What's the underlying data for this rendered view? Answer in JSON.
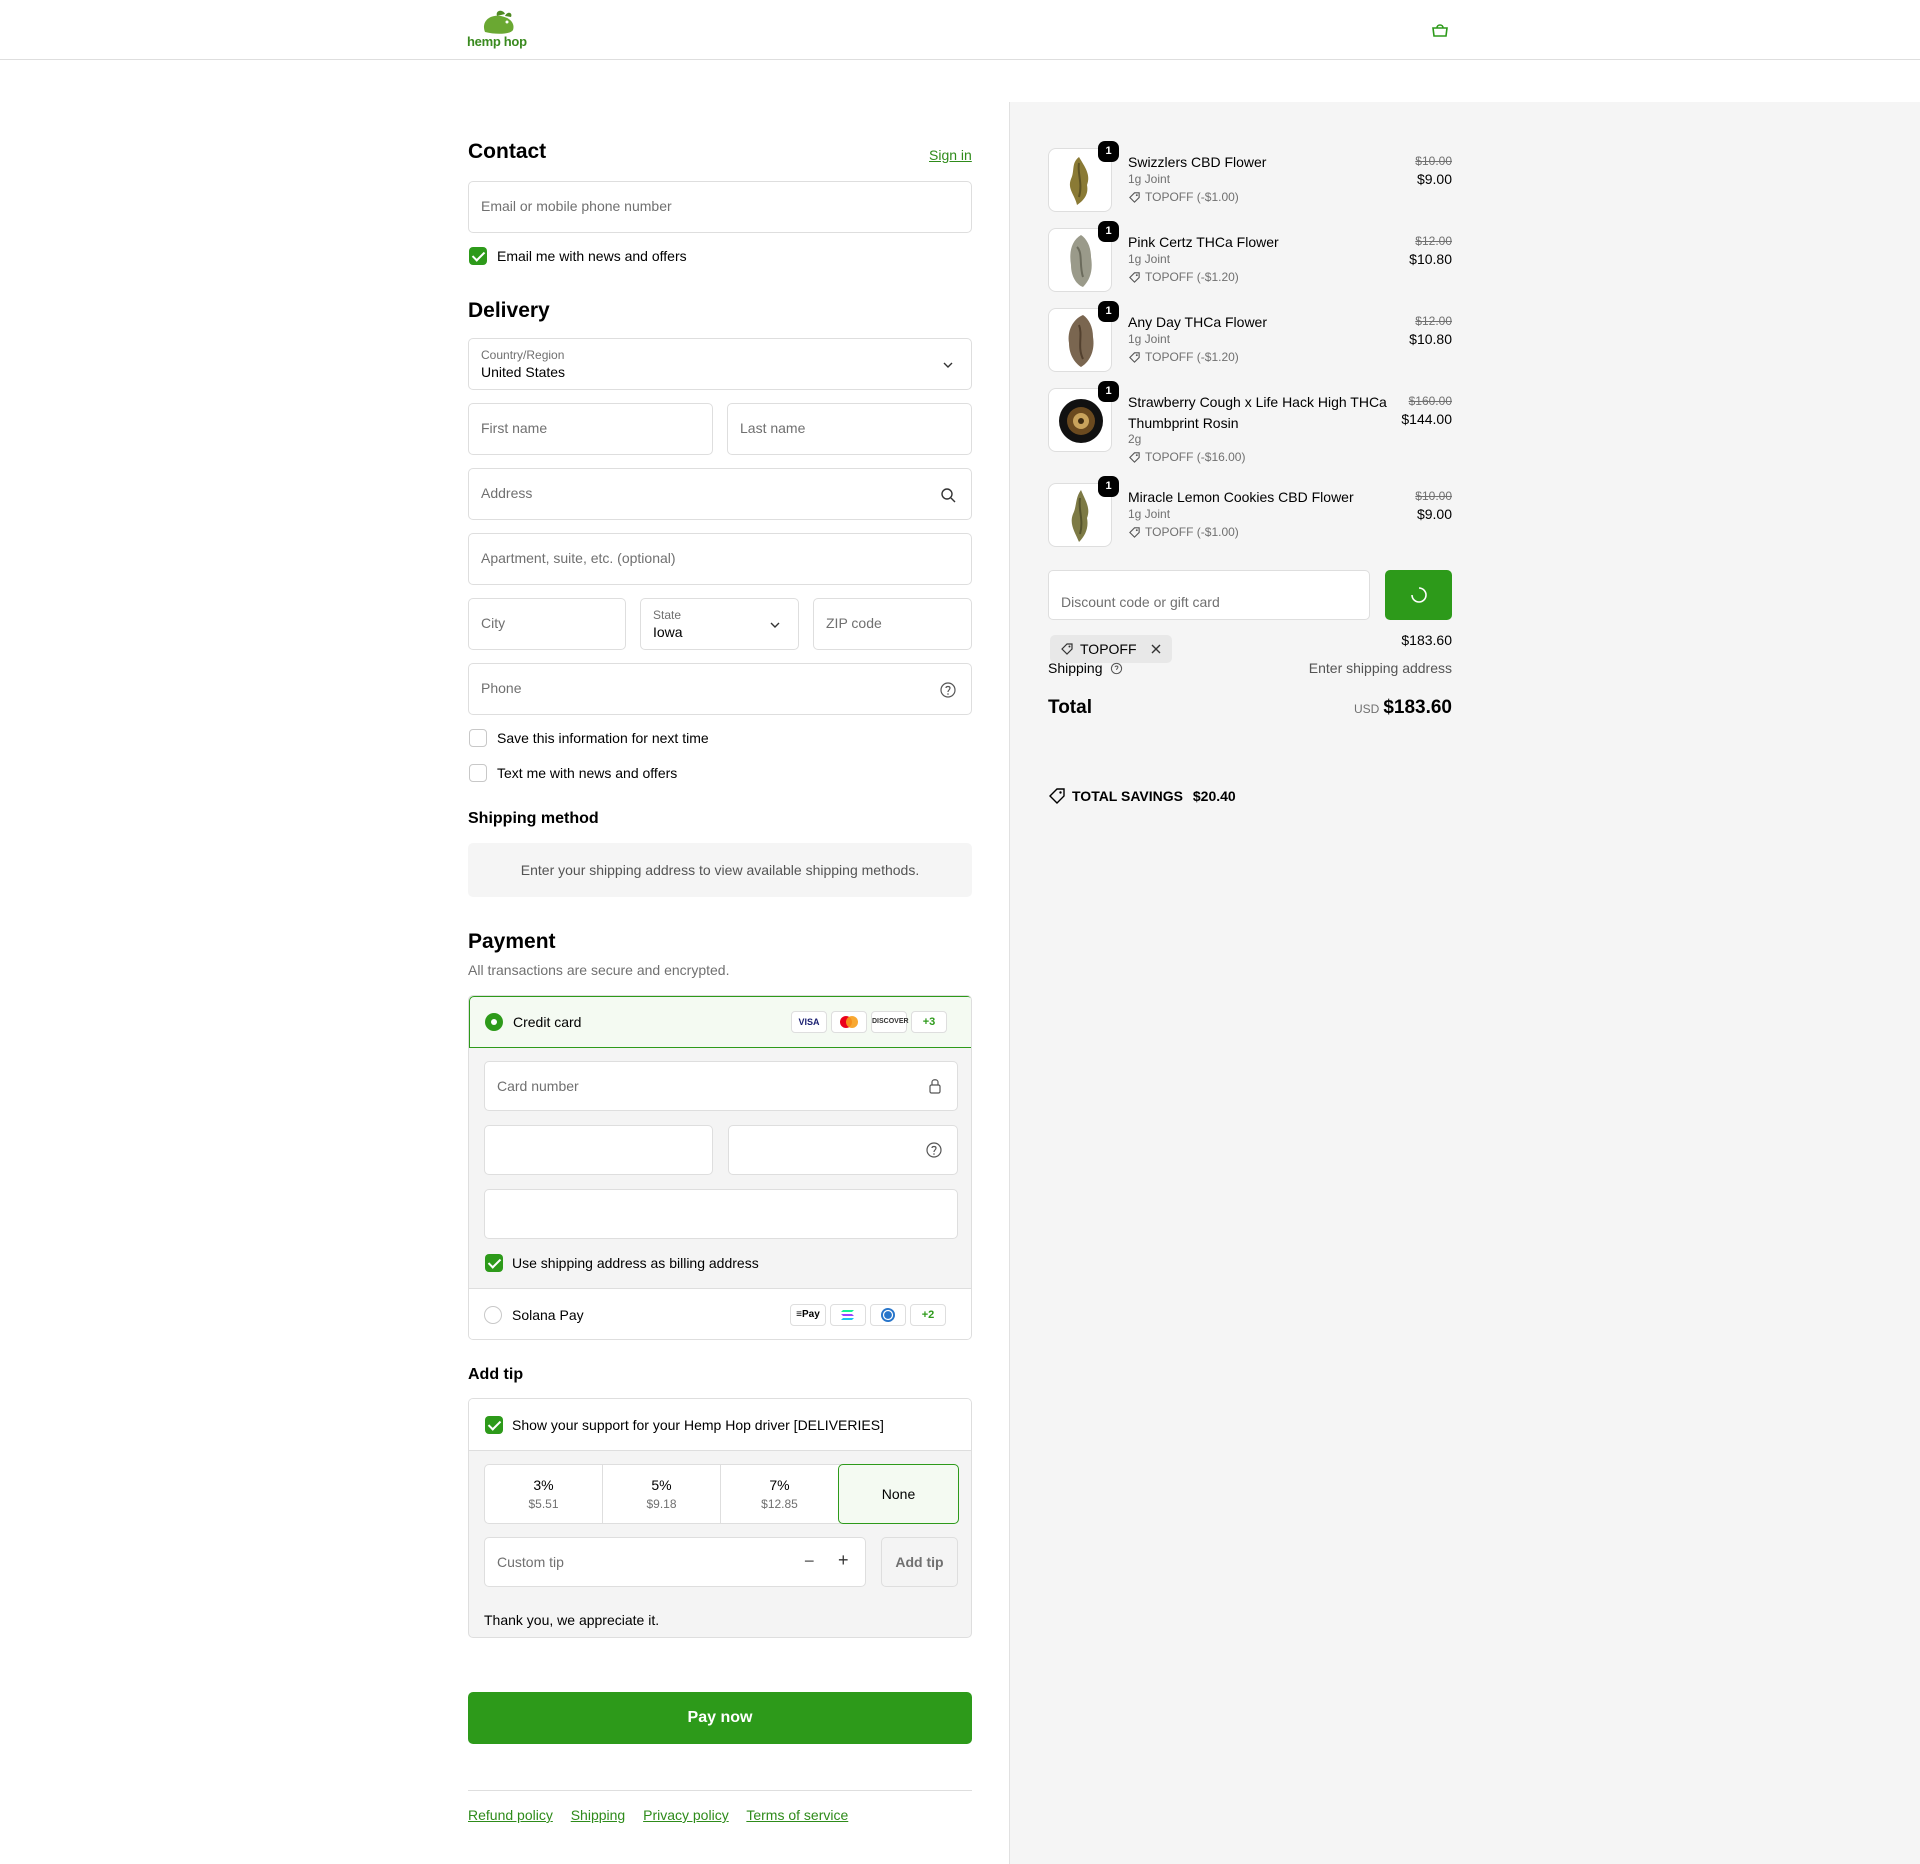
{
  "header": {
    "logo_text": "hemp hop"
  },
  "contact": {
    "title": "Contact",
    "sign_in": "Sign in",
    "email_placeholder": "Email or mobile phone number",
    "news_label": "Email me with news and offers"
  },
  "delivery": {
    "title": "Delivery",
    "country_label": "Country/Region",
    "country_value": "United States",
    "first_name": "First name",
    "last_name": "Last name",
    "address": "Address",
    "apartment": "Apartment, suite, etc. (optional)",
    "city": "City",
    "state_label": "State",
    "state_value": "Iowa",
    "zip": "ZIP code",
    "phone": "Phone",
    "save_info": "Save this information for next time",
    "text_me": "Text me with news and offers"
  },
  "shipping_method": {
    "title": "Shipping method",
    "message": "Enter your shipping address to view available shipping methods."
  },
  "payment": {
    "title": "Payment",
    "subtitle": "All transactions are secure and encrypted.",
    "credit_card": "Credit card",
    "cards": [
      "VISA",
      "",
      "DISCOVER"
    ],
    "cards_more": "+3",
    "card_number": "Card number",
    "billing_label": "Use shipping address as billing address",
    "solana": "Solana Pay",
    "solana_more": "+2",
    "solana_pay_badge": "Pay"
  },
  "tip": {
    "title": "Add tip",
    "support_label": "Show your support for your Hemp Hop driver [DELIVERIES]",
    "options": [
      {
        "pct": "3%",
        "amount": "$5.51"
      },
      {
        "pct": "5%",
        "amount": "$9.18"
      },
      {
        "pct": "7%",
        "amount": "$12.85"
      }
    ],
    "none": "None",
    "custom_placeholder": "Custom tip",
    "minus": "−",
    "plus": "+",
    "add_button": "Add tip",
    "thanks": "Thank you, we appreciate it."
  },
  "pay_now": "Pay now",
  "footer": {
    "links": [
      "Refund policy",
      "Shipping",
      "Privacy policy",
      "Terms of service"
    ]
  },
  "summary": {
    "items": [
      {
        "qty": "1",
        "name": "Swizzlers CBD Flower",
        "variant": "1g Joint",
        "discount": "TOPOFF (-$1.00)",
        "orig": "$10.00",
        "price": "$9.00"
      },
      {
        "qty": "1",
        "name": "Pink Certz THCa Flower",
        "variant": "1g Joint",
        "discount": "TOPOFF (-$1.20)",
        "orig": "$12.00",
        "price": "$10.80"
      },
      {
        "qty": "1",
        "name": "Any Day THCa Flower",
        "variant": "1g Joint",
        "discount": "TOPOFF (-$1.20)",
        "orig": "$12.00",
        "price": "$10.80"
      },
      {
        "qty": "1",
        "name": "Strawberry Cough x Life Hack High THCa Thumbprint Rosin",
        "variant": "2g",
        "discount": "TOPOFF (-$16.00)",
        "orig": "$160.00",
        "price": "$144.00"
      },
      {
        "qty": "1",
        "name": "Miracle Lemon Cookies CBD Flower",
        "variant": "1g Joint",
        "discount": "TOPOFF (-$1.00)",
        "orig": "$10.00",
        "price": "$9.00"
      }
    ],
    "discount_placeholder": "Discount code or gift card",
    "applied_code": "TOPOFF",
    "subtotal_value": "$183.60",
    "shipping_label": "Shipping",
    "shipping_value": "Enter shipping address",
    "total_label": "Total",
    "currency": "USD",
    "total_value": "$183.60",
    "savings_label": "TOTAL SAVINGS",
    "savings_value": "$20.40"
  },
  "colors": {
    "accent": "#2d9a1a",
    "link": "#2e8b1a"
  }
}
